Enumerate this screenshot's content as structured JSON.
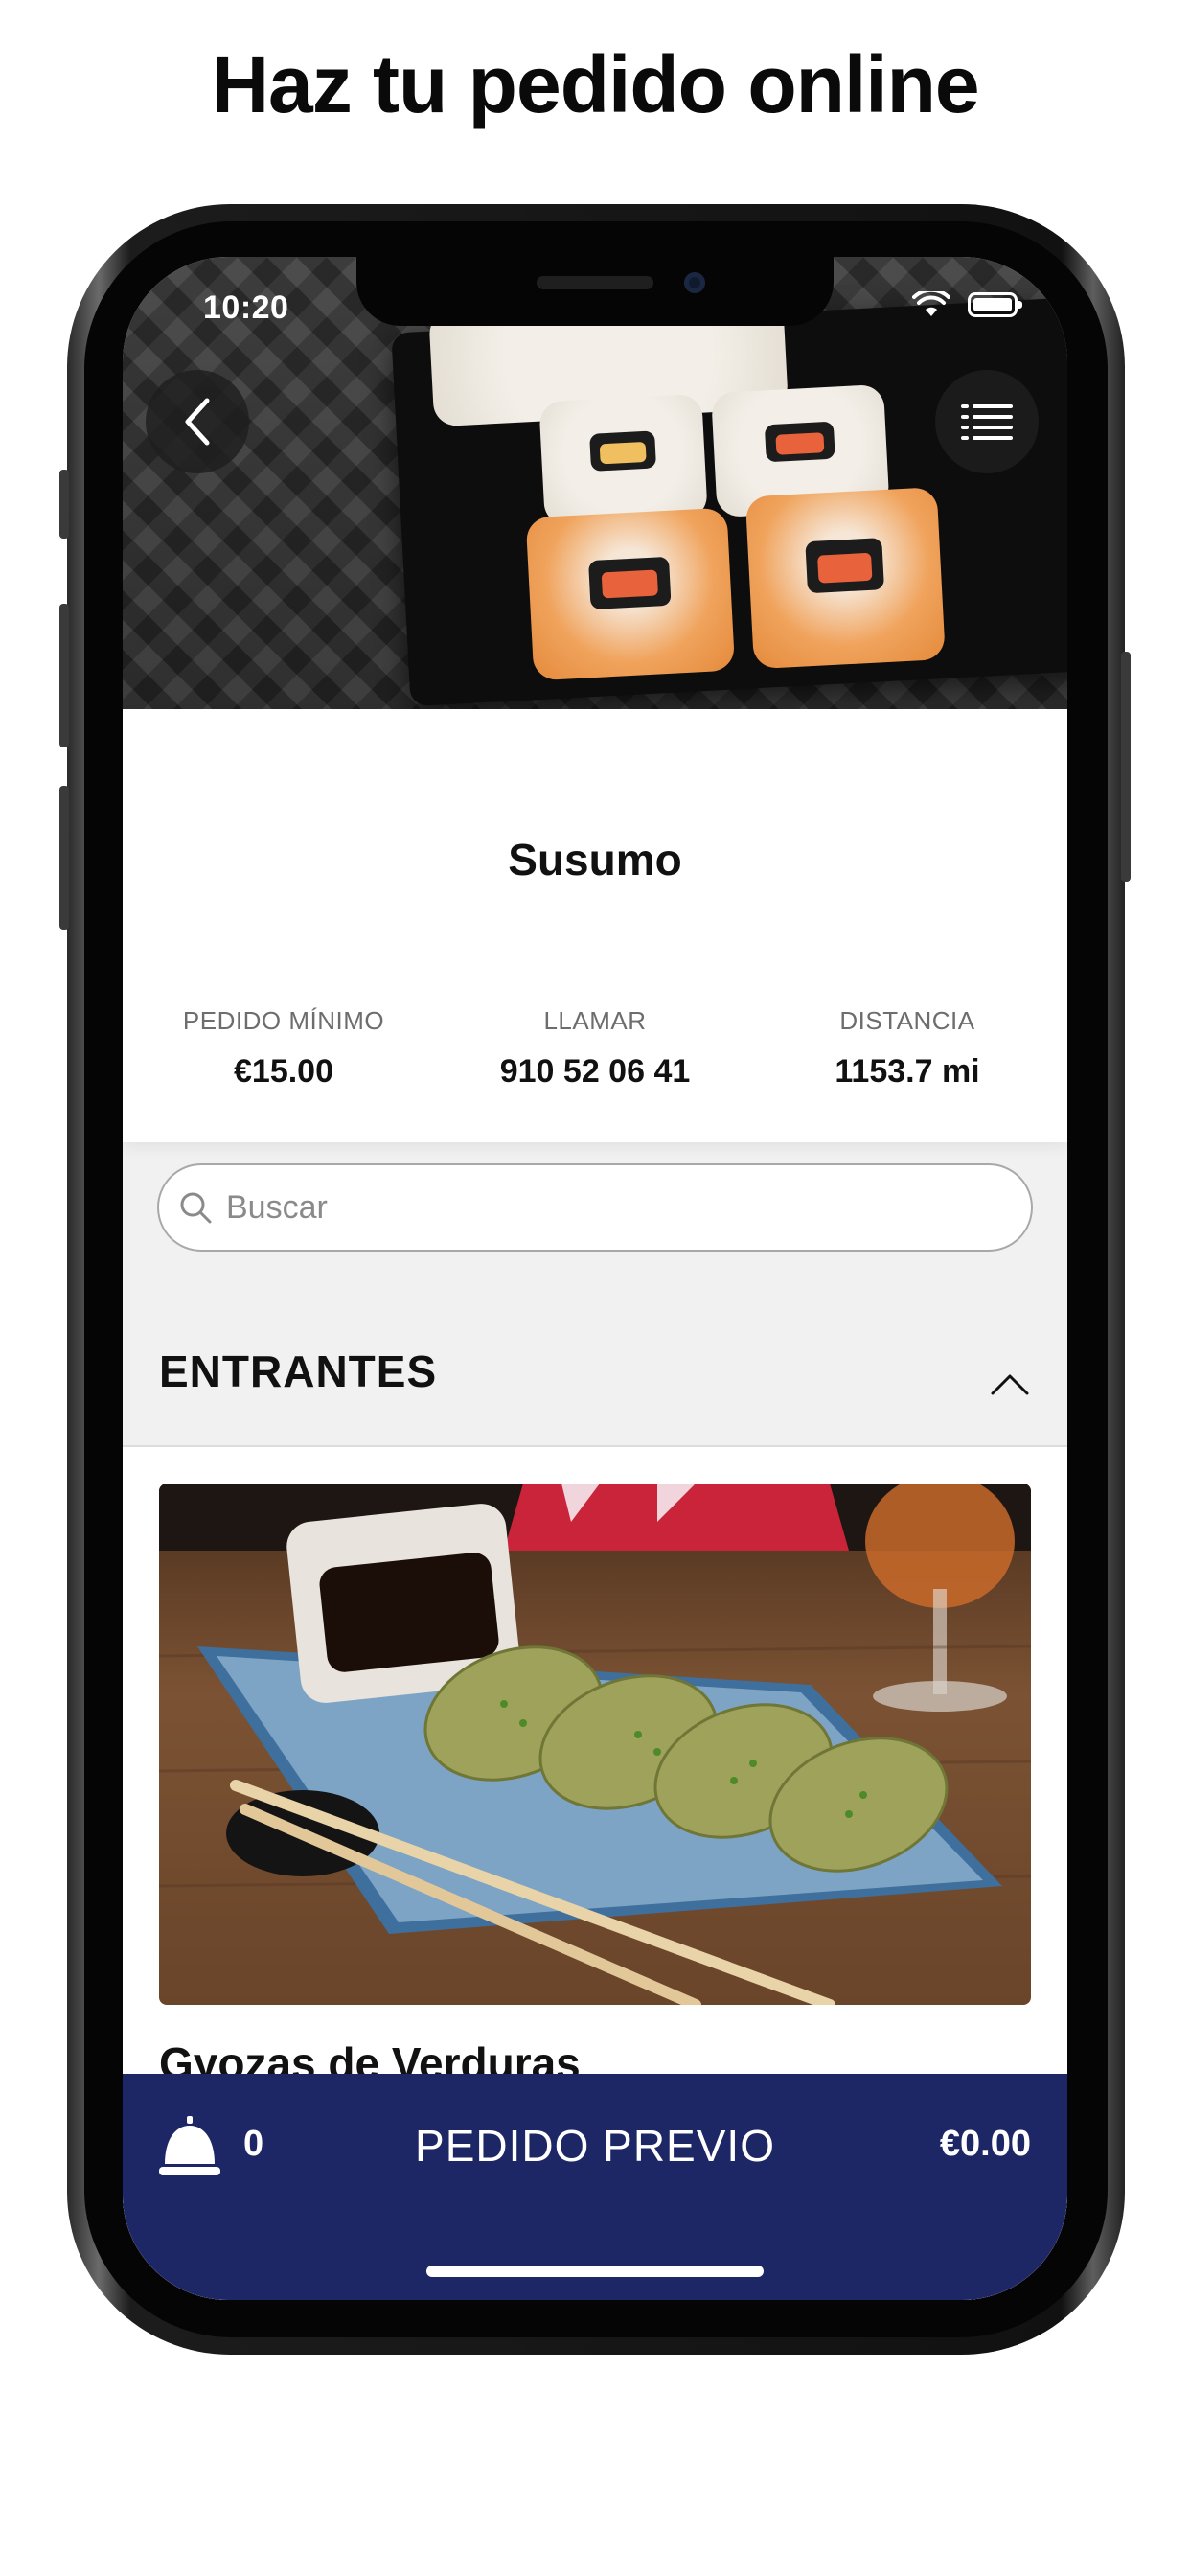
{
  "headline": "Haz tu pedido online",
  "status_bar": {
    "time": "10:20",
    "wifi_icon": "wifi-icon",
    "battery_icon": "battery-icon"
  },
  "header": {
    "back_icon": "chevron-left-icon",
    "menu_icon": "hamburger-menu-icon"
  },
  "restaurant": {
    "name": "Susumo",
    "stats": [
      {
        "label": "PEDIDO MÍNIMO",
        "value": "€15.00"
      },
      {
        "label": "LLAMAR",
        "value": "910 52 06 41"
      },
      {
        "label": "DISTANCIA",
        "value": "1153.7 mi"
      }
    ]
  },
  "search": {
    "placeholder": "Buscar",
    "icon": "search-icon"
  },
  "section": {
    "title": "ENTRANTES",
    "toggle_icon": "chevron-up-icon"
  },
  "items": [
    {
      "name": "Gyozas de Verduras"
    }
  ],
  "order_bar": {
    "icon": "service-bell-icon",
    "count": "0",
    "label": "PEDIDO PREVIO",
    "total": "€0.00"
  },
  "colors": {
    "accent": "#1e2766",
    "section_bg": "#f1f1f1"
  }
}
